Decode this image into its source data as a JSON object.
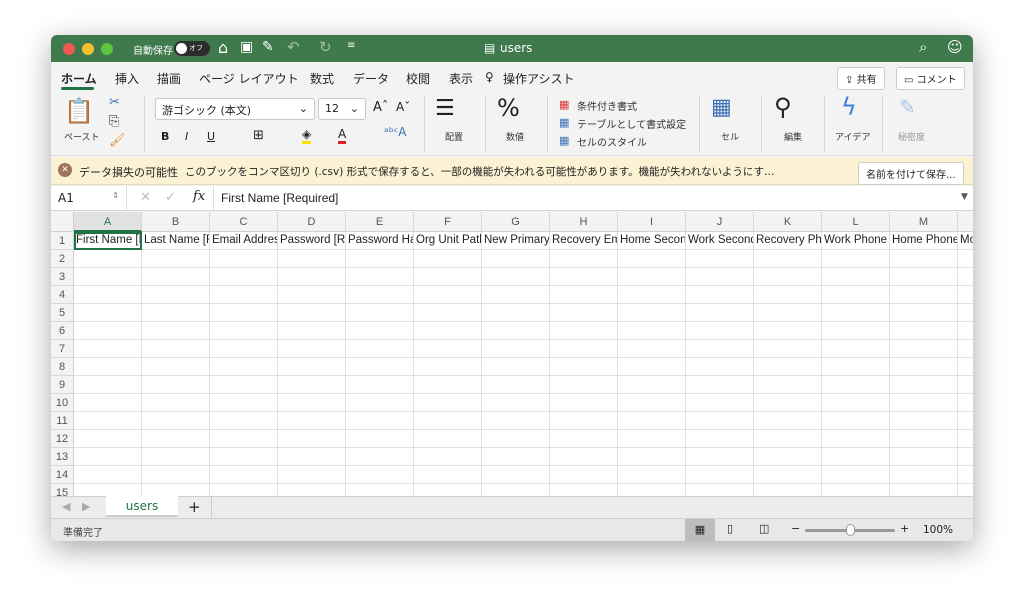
{
  "titlebar": {
    "autosave_label": "自動保存",
    "autosave_state": "オフ",
    "file_name": "users"
  },
  "menu_tabs": [
    "ホーム",
    "挿入",
    "描画",
    "ページ レイアウト",
    "数式",
    "データ",
    "校閲",
    "表示"
  ],
  "tell_me": "操作アシスト",
  "share_label": "共有",
  "comment_label": "コメント",
  "ribbon": {
    "paste": "ペースト",
    "font_name": "游ゴシック (本文)",
    "font_size": "12",
    "bold": "B",
    "italic": "I",
    "underline": "U",
    "align": "配置",
    "number": "数値",
    "cond_format": "条件付き書式",
    "table_format": "テーブルとして書式設定",
    "cell_style": "セルのスタイル",
    "cells": "セル",
    "edit": "編集",
    "ideas": "アイデア",
    "sensitivity": "秘密度"
  },
  "warning": {
    "title": "データ損失の可能性",
    "message": "このブックをコンマ区切り (.csv) 形式で保存すると、一部の機能が失われる可能性があります。機能が失われないようにす…",
    "button": "名前を付けて保存..."
  },
  "formula_bar": {
    "cell_ref": "A1",
    "fx": "fx",
    "value": "First Name [Required]"
  },
  "columns": [
    "A",
    "B",
    "C",
    "D",
    "E",
    "F",
    "G",
    "H",
    "I",
    "J",
    "K",
    "L",
    "M"
  ],
  "rows": [
    "1",
    "2",
    "3",
    "4",
    "5",
    "6",
    "7",
    "8",
    "9",
    "10",
    "11",
    "12",
    "13",
    "14",
    "15"
  ],
  "row1": [
    "First Name [Required]",
    "Last Name [Required]",
    "Email Address [Required]",
    "Password [Required]",
    "Password Hash Function",
    "Org Unit Path [Required]",
    "New Primary Email",
    "Recovery Email",
    "Home Secondary Email",
    "Work Secondary Email",
    "Recovery Phone",
    "Work Phone",
    "Home Phone",
    "Mobile Phone"
  ],
  "sheet_tabs": [
    "users"
  ],
  "add_sheet": "+",
  "status": {
    "ready": "準備完了",
    "zoom": "100%",
    "zoom_level": 100
  },
  "colors": {
    "title_bar": "#3e7a4b",
    "accent": "#217346"
  }
}
